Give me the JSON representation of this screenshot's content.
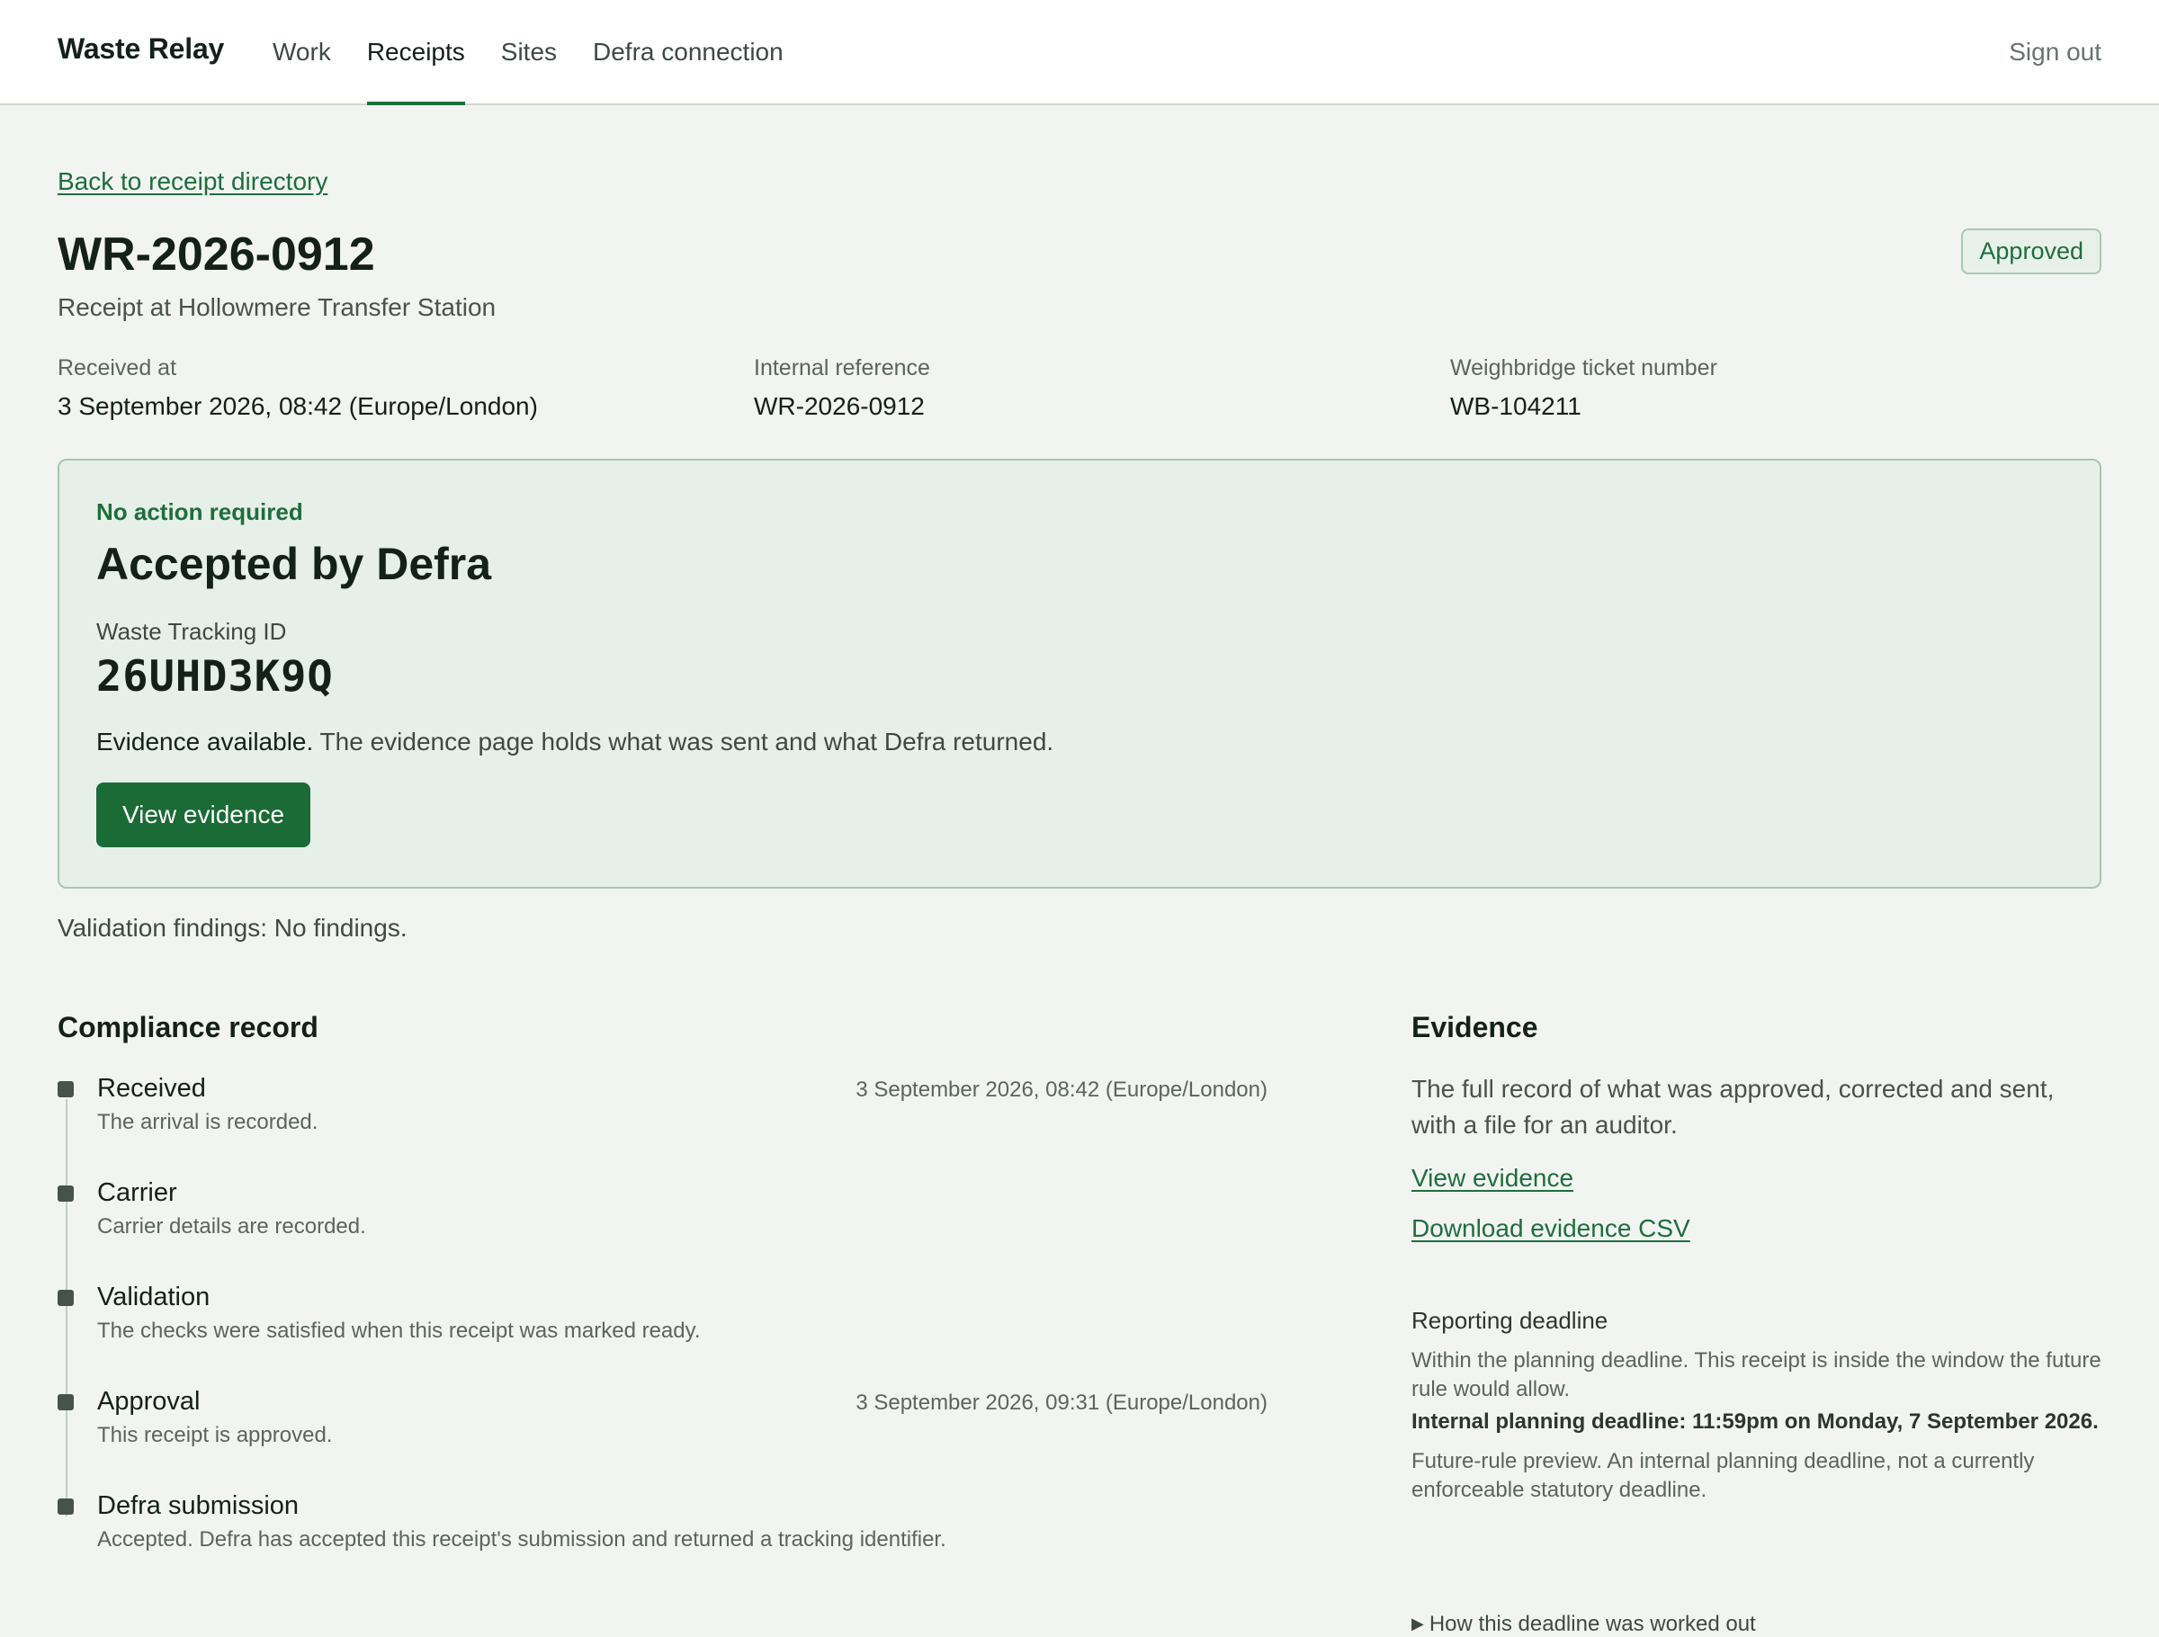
{
  "header": {
    "brand": "Waste Relay",
    "nav": [
      "Work",
      "Receipts",
      "Sites",
      "Defra connection"
    ],
    "active_nav": "Receipts",
    "sign_out": "Sign out"
  },
  "page": {
    "back_link": "Back to receipt directory",
    "title": "WR-2026-0912",
    "status": "Approved",
    "subtitle": "Receipt at Hollowmere Transfer Station"
  },
  "meta": [
    {
      "label": "Received at",
      "value": "3 September 2026, 08:42 (Europe/London)"
    },
    {
      "label": "Internal reference",
      "value": "WR-2026-0912"
    },
    {
      "label": "Weighbridge ticket number",
      "value": "WB-104211"
    }
  ],
  "panel": {
    "kicker": "No action required",
    "heading": "Accepted by Defra",
    "id_label": "Waste Tracking ID",
    "id_value": "26UHD3K9Q",
    "evidence_strong": "Evidence available.",
    "evidence_text": " The evidence page holds what was sent and what Defra returned.",
    "button": "View evidence"
  },
  "findings": "Validation findings: No findings.",
  "compliance": {
    "title": "Compliance record",
    "items": [
      {
        "title": "Received",
        "desc": "The arrival is recorded.",
        "time": "3 September 2026, 08:42 (Europe/London)"
      },
      {
        "title": "Carrier",
        "desc": "Carrier details are recorded.",
        "time": ""
      },
      {
        "title": "Validation",
        "desc": "The checks were satisfied when this receipt was marked ready.",
        "time": ""
      },
      {
        "title": "Approval",
        "desc": "This receipt is approved.",
        "time": "3 September 2026, 09:31 (Europe/London)"
      },
      {
        "title": "Defra submission",
        "desc": "Accepted. Defra has accepted this receipt's submission and returned a tracking identifier.",
        "time": ""
      }
    ]
  },
  "evidence": {
    "title": "Evidence",
    "description": "The full record of what was approved, corrected and sent, with a file for an auditor.",
    "view_link": "View evidence",
    "download_link": "Download evidence CSV",
    "deadline": {
      "title": "Reporting deadline",
      "status_text": "Within the planning deadline. This receipt is inside the window the future rule would allow.",
      "planning_deadline": "Internal planning deadline: 11:59pm on Monday, 7 September 2026.",
      "preview_text": "Future-rule preview. An internal planning deadline, not a currently enforceable statutory deadline.",
      "details_toggle": "How this deadline was worked out"
    }
  }
}
